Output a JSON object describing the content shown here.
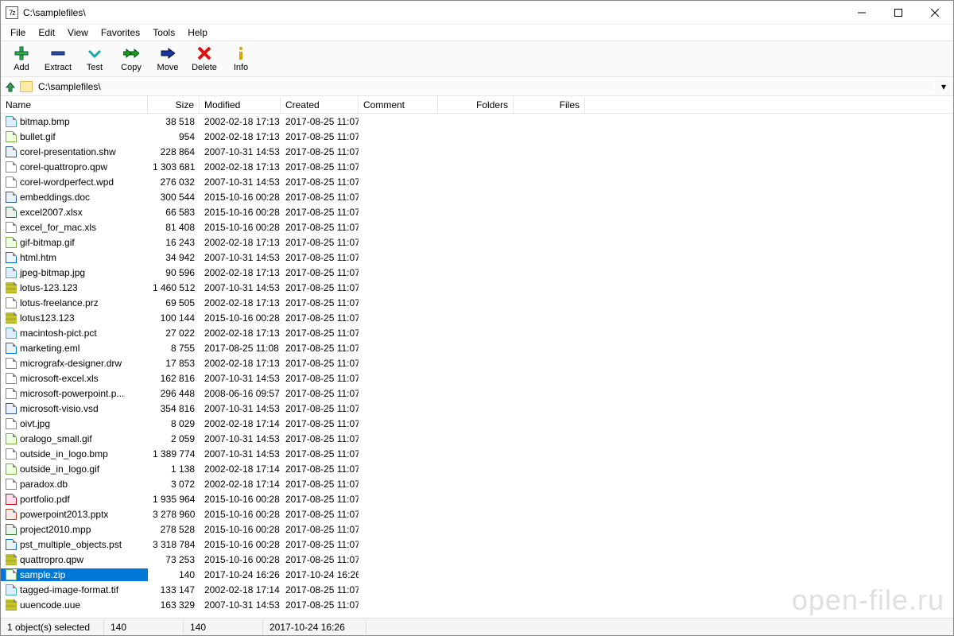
{
  "title": "C:\\samplefiles\\",
  "app_icon_text": "7z",
  "menu": [
    "File",
    "Edit",
    "View",
    "Favorites",
    "Tools",
    "Help"
  ],
  "toolbar": [
    {
      "name": "add",
      "label": "Add"
    },
    {
      "name": "extract",
      "label": "Extract"
    },
    {
      "name": "test",
      "label": "Test"
    },
    {
      "name": "copy",
      "label": "Copy"
    },
    {
      "name": "move",
      "label": "Move"
    },
    {
      "name": "delete",
      "label": "Delete"
    },
    {
      "name": "info",
      "label": "Info"
    }
  ],
  "path": "C:\\samplefiles\\",
  "columns": [
    "Name",
    "Size",
    "Modified",
    "Created",
    "Comment",
    "Folders",
    "Files"
  ],
  "files": [
    {
      "icon": "ic-img",
      "name": "bitmap.bmp",
      "size": "38 518",
      "modified": "2002-02-18 17:13",
      "created": "2017-08-25 11:07"
    },
    {
      "icon": "ic-gif",
      "name": "bullet.gif",
      "size": "954",
      "modified": "2002-02-18 17:13",
      "created": "2017-08-25 11:07"
    },
    {
      "icon": "ic-doc",
      "name": "corel-presentation.shw",
      "size": "228 864",
      "modified": "2007-10-31 14:53",
      "created": "2017-08-25 11:07"
    },
    {
      "icon": "",
      "name": "corel-quattropro.qpw",
      "size": "1 303 681",
      "modified": "2002-02-18 17:13",
      "created": "2017-08-25 11:07"
    },
    {
      "icon": "",
      "name": "corel-wordperfect.wpd",
      "size": "276 032",
      "modified": "2007-10-31 14:53",
      "created": "2017-08-25 11:07"
    },
    {
      "icon": "ic-doc",
      "name": "embeddings.doc",
      "size": "300 544",
      "modified": "2015-10-16 00:28",
      "created": "2017-08-25 11:07"
    },
    {
      "icon": "ic-xls",
      "name": "excel2007.xlsx",
      "size": "66 583",
      "modified": "2015-10-16 00:28",
      "created": "2017-08-25 11:07"
    },
    {
      "icon": "",
      "name": "excel_for_mac.xls",
      "size": "81 408",
      "modified": "2015-10-16 00:28",
      "created": "2017-08-25 11:07"
    },
    {
      "icon": "ic-gif",
      "name": "gif-bitmap.gif",
      "size": "16 243",
      "modified": "2002-02-18 17:13",
      "created": "2017-08-25 11:07"
    },
    {
      "icon": "ic-htm",
      "name": "html.htm",
      "size": "34 942",
      "modified": "2007-10-31 14:53",
      "created": "2017-08-25 11:07"
    },
    {
      "icon": "ic-img",
      "name": "jpeg-bitmap.jpg",
      "size": "90 596",
      "modified": "2002-02-18 17:13",
      "created": "2017-08-25 11:07"
    },
    {
      "icon": "ic-archive",
      "name": "lotus-123.123",
      "size": "1 460 512",
      "modified": "2007-10-31 14:53",
      "created": "2017-08-25 11:07"
    },
    {
      "icon": "",
      "name": "lotus-freelance.prz",
      "size": "69 505",
      "modified": "2002-02-18 17:13",
      "created": "2017-08-25 11:07"
    },
    {
      "icon": "ic-archive",
      "name": "lotus123.123",
      "size": "100 144",
      "modified": "2015-10-16 00:28",
      "created": "2017-08-25 11:07"
    },
    {
      "icon": "ic-img",
      "name": "macintosh-pict.pct",
      "size": "27 022",
      "modified": "2002-02-18 17:13",
      "created": "2017-08-25 11:07"
    },
    {
      "icon": "ic-eml",
      "name": "marketing.eml",
      "size": "8 755",
      "modified": "2017-08-25 11:08",
      "created": "2017-08-25 11:07"
    },
    {
      "icon": "",
      "name": "micrografx-designer.drw",
      "size": "17 853",
      "modified": "2002-02-18 17:13",
      "created": "2017-08-25 11:07"
    },
    {
      "icon": "",
      "name": "microsoft-excel.xls",
      "size": "162 816",
      "modified": "2007-10-31 14:53",
      "created": "2017-08-25 11:07"
    },
    {
      "icon": "",
      "name": "microsoft-powerpoint.p...",
      "size": "296 448",
      "modified": "2008-06-16 09:57",
      "created": "2017-08-25 11:07"
    },
    {
      "icon": "ic-vsd",
      "name": "microsoft-visio.vsd",
      "size": "354 816",
      "modified": "2007-10-31 14:53",
      "created": "2017-08-25 11:07"
    },
    {
      "icon": "",
      "name": "oivt.jpg",
      "size": "8 029",
      "modified": "2002-02-18 17:14",
      "created": "2017-08-25 11:07"
    },
    {
      "icon": "ic-gif",
      "name": "oralogo_small.gif",
      "size": "2 059",
      "modified": "2007-10-31 14:53",
      "created": "2017-08-25 11:07"
    },
    {
      "icon": "",
      "name": "outside_in_logo.bmp",
      "size": "1 389 774",
      "modified": "2007-10-31 14:53",
      "created": "2017-08-25 11:07"
    },
    {
      "icon": "ic-gif",
      "name": "outside_in_logo.gif",
      "size": "1 138",
      "modified": "2002-02-18 17:14",
      "created": "2017-08-25 11:07"
    },
    {
      "icon": "",
      "name": "paradox.db",
      "size": "3 072",
      "modified": "2002-02-18 17:14",
      "created": "2017-08-25 11:07"
    },
    {
      "icon": "ic-pdf",
      "name": "portfolio.pdf",
      "size": "1 935 964",
      "modified": "2015-10-16 00:28",
      "created": "2017-08-25 11:07"
    },
    {
      "icon": "ic-ppt",
      "name": "powerpoint2013.pptx",
      "size": "3 278 960",
      "modified": "2015-10-16 00:28",
      "created": "2017-08-25 11:07"
    },
    {
      "icon": "ic-proj",
      "name": "project2010.mpp",
      "size": "278 528",
      "modified": "2015-10-16 00:28",
      "created": "2017-08-25 11:07"
    },
    {
      "icon": "ic-eml",
      "name": "pst_multiple_objects.pst",
      "size": "3 318 784",
      "modified": "2015-10-16 00:28",
      "created": "2017-08-25 11:07"
    },
    {
      "icon": "ic-archive",
      "name": "quattropro.qpw",
      "size": "73 253",
      "modified": "2015-10-16 00:28",
      "created": "2017-08-25 11:07"
    },
    {
      "icon": "ic-zip",
      "name": "sample.zip",
      "size": "140",
      "modified": "2017-10-24 16:26",
      "created": "2017-10-24 16:26",
      "selected": true
    },
    {
      "icon": "ic-img",
      "name": "tagged-image-format.tif",
      "size": "133 147",
      "modified": "2002-02-18 17:14",
      "created": "2017-08-25 11:07"
    },
    {
      "icon": "ic-archive",
      "name": "uuencode.uue",
      "size": "163 329",
      "modified": "2007-10-31 14:53",
      "created": "2017-08-25 11:07"
    }
  ],
  "status": {
    "selection": "1 object(s) selected",
    "size1": "140",
    "size2": "140",
    "date": "2017-10-24 16:26"
  },
  "watermark": "open-file.ru"
}
